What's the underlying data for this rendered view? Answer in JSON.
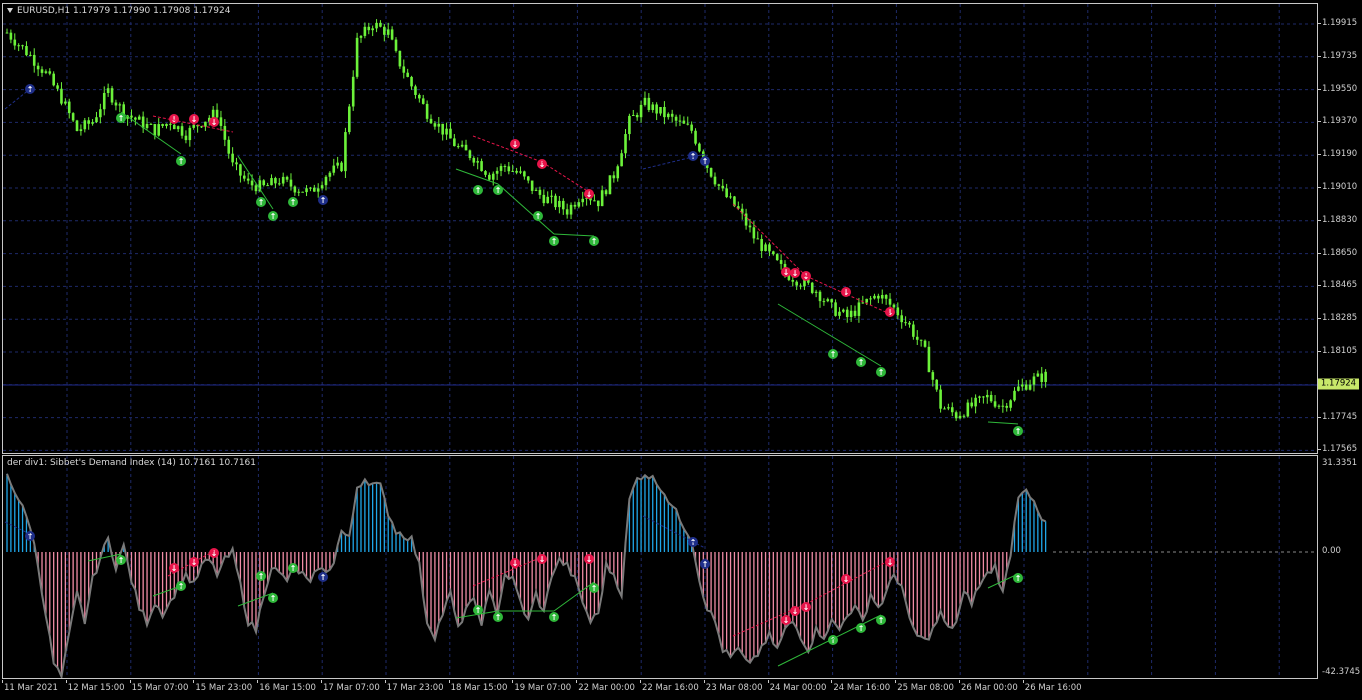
{
  "main": {
    "title": "EURUSD,H1  1.17979 1.17990 1.17908 1.17924",
    "current_price": "1.17924",
    "y_labels": [
      "1.19915",
      "1.19735",
      "1.19550",
      "1.19370",
      "1.19190",
      "1.19010",
      "1.18830",
      "1.18650",
      "1.18465",
      "1.18285",
      "1.18105",
      "1.17745",
      "1.17565"
    ]
  },
  "indicator": {
    "title": "der div1:  Sibbet's Demand Index (14) 10.7161 10.7161",
    "y_labels": [
      "31.3351",
      "0.00",
      "-42.3745"
    ]
  },
  "x_labels": [
    "11 Mar 2021",
    "12 Mar 15:00",
    "15 Mar 07:00",
    "15 Mar 23:00",
    "16 Mar 15:00",
    "17 Mar 07:00",
    "17 Mar 23:00",
    "18 Mar 15:00",
    "19 Mar 07:00",
    "22 Mar 00:00",
    "22 Mar 16:00",
    "23 Mar 08:00",
    "24 Mar 00:00",
    "24 Mar 16:00",
    "25 Mar 08:00",
    "26 Mar 00:00",
    "26 Mar 16:00"
  ],
  "colors": {
    "candle": "#6cf23a",
    "grid": "#1e2a6a",
    "price_line": "#1f2a8a",
    "up_arrow": "#2fb83a",
    "down_arrow": "#e8154a",
    "neutral_arrow": "#1f2f8a",
    "hist_pos": "#1fa6e8",
    "hist_neg": "#f08ca6",
    "di_line": "#7a7a7a"
  },
  "chart_data": {
    "type": "candlestick",
    "symbol": "EURUSD",
    "timeframe": "H1",
    "ohlc_last": {
      "open": 1.17979,
      "high": 1.1799,
      "low": 1.17908,
      "close": 1.17924
    },
    "ylim": [
      1.17565,
      1.19915
    ],
    "close_path": [
      [
        0,
        1.1985
      ],
      [
        6,
        1.1972
      ],
      [
        10,
        1.1962
      ],
      [
        14,
        1.1948
      ],
      [
        18,
        1.193
      ],
      [
        22,
        1.1935
      ],
      [
        26,
        1.1952
      ],
      [
        30,
        1.194
      ],
      [
        34,
        1.1935
      ],
      [
        38,
        1.193
      ],
      [
        42,
        1.1935
      ],
      [
        46,
        1.1928
      ],
      [
        50,
        1.1935
      ],
      [
        54,
        1.194
      ],
      [
        58,
        1.191
      ],
      [
        62,
        1.19
      ],
      [
        66,
        1.1898
      ],
      [
        70,
        1.1902
      ],
      [
        74,
        1.1898
      ],
      [
        78,
        1.1895
      ],
      [
        82,
        1.1905
      ],
      [
        86,
        1.191
      ],
      [
        90,
        1.198
      ],
      [
        94,
        1.199
      ],
      [
        98,
        1.1985
      ],
      [
        100,
        1.1972
      ],
      [
        104,
        1.1955
      ],
      [
        108,
        1.194
      ],
      [
        112,
        1.193
      ],
      [
        116,
        1.192
      ],
      [
        120,
        1.1915
      ],
      [
        124,
        1.1905
      ],
      [
        128,
        1.191
      ],
      [
        132,
        1.1905
      ],
      [
        136,
        1.1895
      ],
      [
        140,
        1.189
      ],
      [
        144,
        1.1885
      ],
      [
        148,
        1.1895
      ],
      [
        152,
        1.189
      ],
      [
        156,
        1.1905
      ],
      [
        160,
        1.1935
      ],
      [
        164,
        1.1945
      ],
      [
        168,
        1.194
      ],
      [
        172,
        1.1935
      ],
      [
        176,
        1.193
      ],
      [
        180,
        1.191
      ],
      [
        184,
        1.1895
      ],
      [
        188,
        1.1885
      ],
      [
        192,
        1.187
      ],
      [
        196,
        1.186
      ],
      [
        200,
        1.185
      ],
      [
        204,
        1.1845
      ],
      [
        208,
        1.184
      ],
      [
        212,
        1.183
      ],
      [
        216,
        1.1825
      ],
      [
        220,
        1.1832
      ],
      [
        224,
        1.1838
      ],
      [
        228,
        1.183
      ],
      [
        232,
        1.182
      ],
      [
        236,
        1.1805
      ],
      [
        240,
        1.1775
      ],
      [
        244,
        1.177
      ],
      [
        248,
        1.1775
      ],
      [
        252,
        1.178
      ],
      [
        256,
        1.1775
      ],
      [
        260,
        1.1785
      ],
      [
        264,
        1.179
      ],
      [
        267,
        1.1792
      ]
    ],
    "indicator": {
      "name": "Sibbet's Demand Index",
      "period": 14,
      "value": 10.7161,
      "ylim": [
        -42.3745,
        31.3351
      ]
    }
  }
}
